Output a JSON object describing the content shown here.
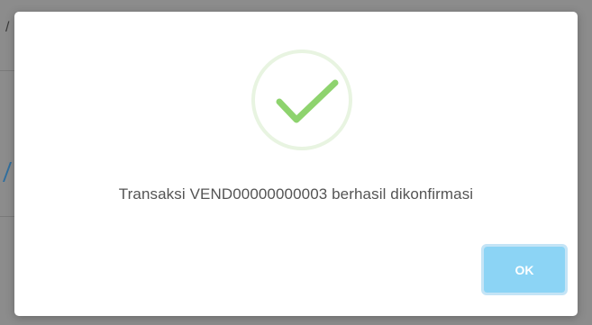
{
  "dialog": {
    "icon": "checkmark-success-icon",
    "message": "Transaksi VEND00000000003 berhasil dikonfirmasi",
    "confirm_label": "OK"
  },
  "colors": {
    "success_check": "#8ed36e",
    "success_ring": "#e8f4e1",
    "confirm_button": "#8cd4f5",
    "message_text": "#545454",
    "overlay": "#8c8c8c"
  }
}
